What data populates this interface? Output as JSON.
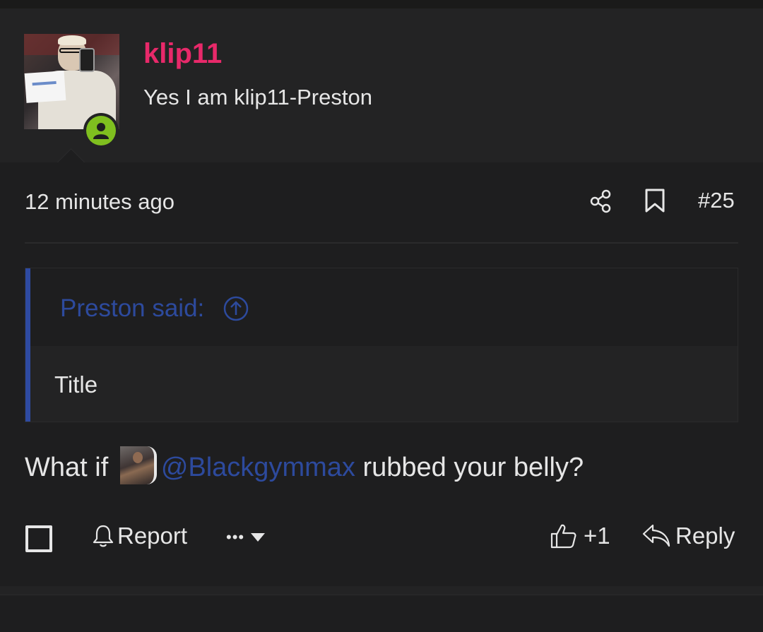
{
  "user": {
    "username": "klip11",
    "title": "Yes I am klip11-Preston",
    "username_color": "#e8296a",
    "status_color": "#7fbf1f"
  },
  "post": {
    "time": "12 minutes ago",
    "number": "#25",
    "share_icon": "share-icon",
    "bookmark_icon": "bookmark-icon"
  },
  "quote": {
    "author_line": "Preston said:",
    "text": "Title"
  },
  "message": {
    "prefix": "What if",
    "mention": "@Blackgymmax",
    "suffix": "rubbed your belly?"
  },
  "actions": {
    "report_label": "Report",
    "more_label": "•••",
    "like_label": "+1",
    "reply_label": "Reply"
  },
  "colors": {
    "background": "#1e1e1f",
    "panel": "#232324",
    "link": "#2d4a9d",
    "quote_bar": "#2e4aa1"
  }
}
